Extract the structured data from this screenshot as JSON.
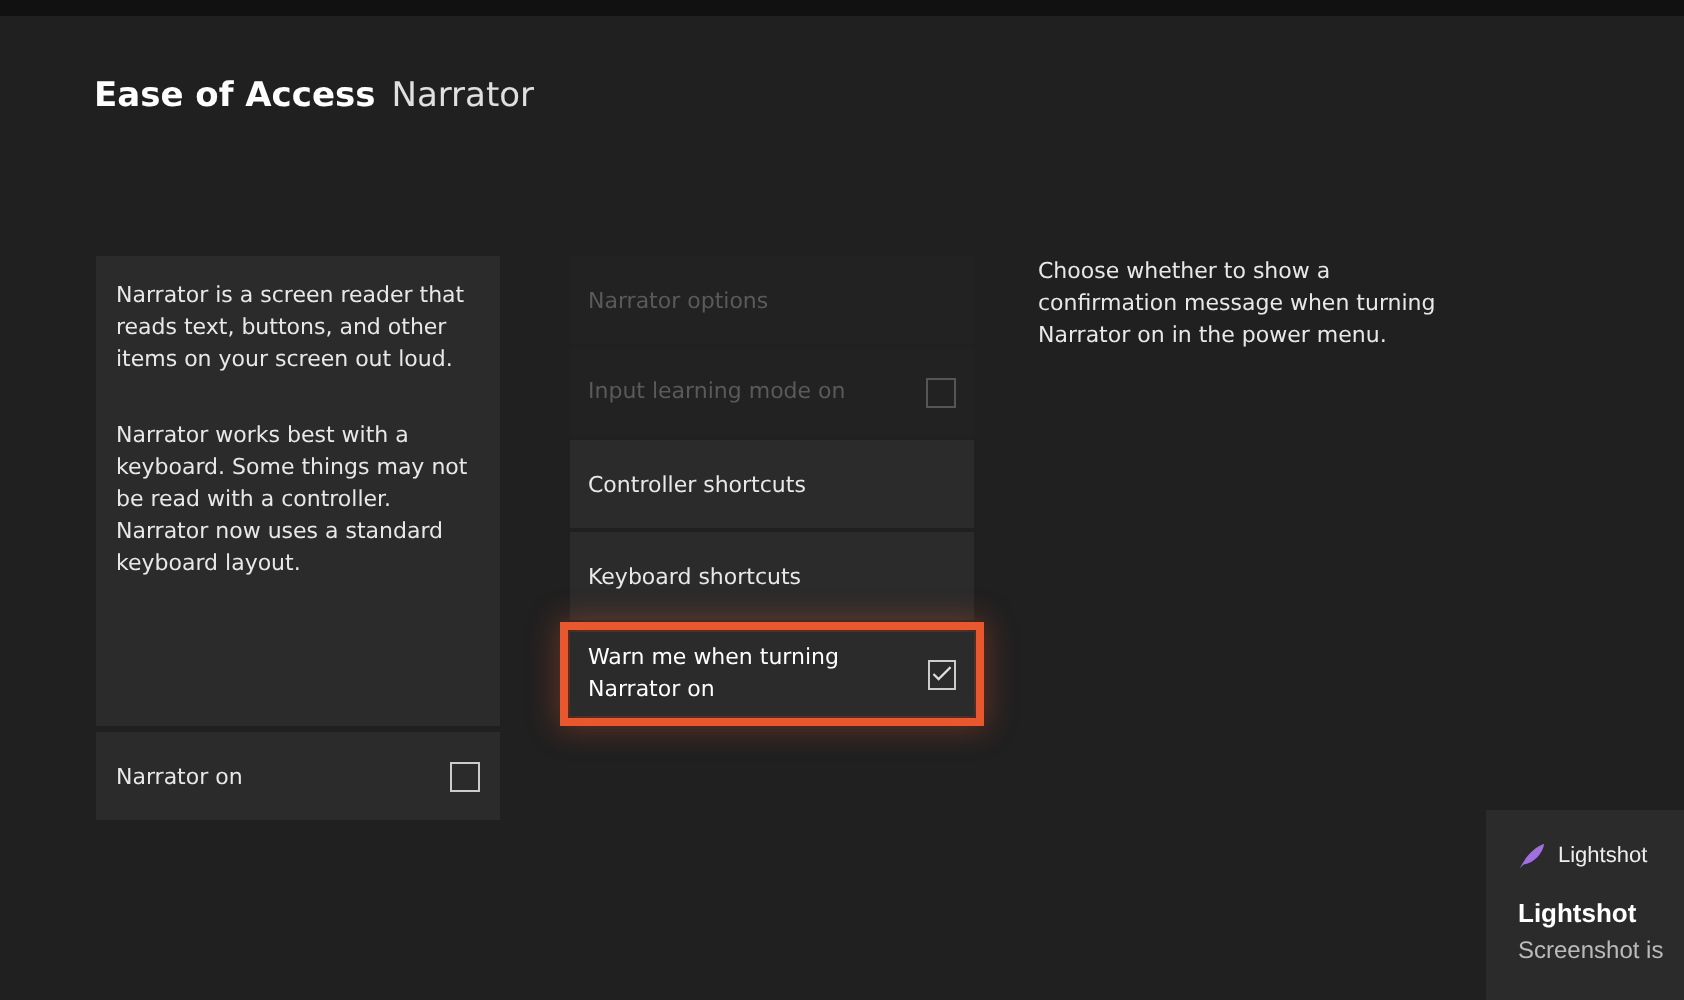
{
  "header": {
    "section": "Ease of Access",
    "page": "Narrator"
  },
  "info_panel": {
    "paragraphs": [
      "Narrator is a screen reader that reads text, buttons, and other items on your screen out loud.",
      "Narrator works best with a keyboard. Some things may not be read with a controller. Narrator now uses a standard keyboard layout."
    ],
    "toggle": {
      "label": "Narrator on",
      "checked": false
    }
  },
  "options": [
    {
      "kind": "heading",
      "label": "Narrator options",
      "disabled": true,
      "focused": false
    },
    {
      "kind": "checkbox",
      "label": "Input learning mode on",
      "checked": false,
      "disabled": true,
      "focused": false
    },
    {
      "kind": "link",
      "label": "Controller shortcuts",
      "disabled": false,
      "focused": false
    },
    {
      "kind": "link",
      "label": "Keyboard shortcuts",
      "disabled": false,
      "focused": false
    },
    {
      "kind": "checkbox",
      "label": "Warn me when turning Narrator on",
      "checked": true,
      "disabled": false,
      "focused": true
    }
  ],
  "help_text": "Choose whether to show a confirmation message when turning Narrator on in the power menu.",
  "notification": {
    "app": "Lightshot",
    "title": "Lightshot",
    "body": "Screenshot is"
  }
}
